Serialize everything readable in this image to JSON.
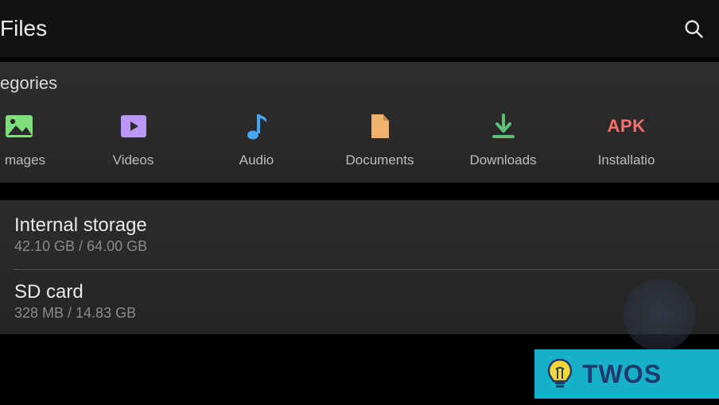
{
  "app": {
    "title": "Files"
  },
  "categories": {
    "heading_partial": "egories",
    "items": [
      {
        "label": "mages",
        "icon": "image-icon"
      },
      {
        "label": "Videos",
        "icon": "video-icon"
      },
      {
        "label": "Audio",
        "icon": "audio-icon"
      },
      {
        "label": "Documents",
        "icon": "document-icon"
      },
      {
        "label": "Downloads",
        "icon": "download-icon"
      },
      {
        "label": "Installatio",
        "icon": "apk-icon",
        "apk_text": "APK"
      }
    ]
  },
  "storage": {
    "internal": {
      "title": "Internal storage",
      "subtitle": "42.10 GB / 64.00 GB"
    },
    "sd": {
      "title": "SD card",
      "subtitle": "328 MB / 14.83 GB"
    }
  },
  "watermark": {
    "text": "TWOS"
  },
  "colors": {
    "images_icon": "#7de07a",
    "videos_icon": "#b998f7",
    "audio_icon": "#4aa5f0",
    "docs_icon": "#f2b26f",
    "dl_icon": "#62bd76",
    "apk_text": "#fc6f6b",
    "badge_bg": "#16b0c8",
    "badge_fg": "#213a6b"
  }
}
